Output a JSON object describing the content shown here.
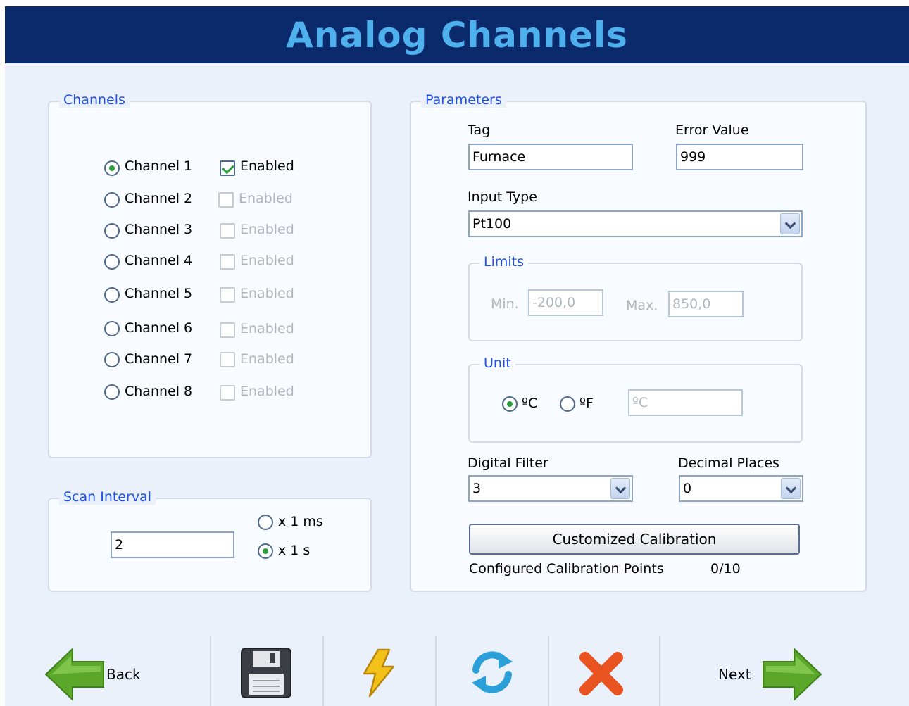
{
  "title": "Analog Channels",
  "channels": {
    "title": "Channels",
    "items": [
      {
        "label": "Channel 1",
        "enabled_label": "Enabled"
      },
      {
        "label": "Channel 2",
        "enabled_label": "Enabled"
      },
      {
        "label": "Channel 3",
        "enabled_label": "Enabled"
      },
      {
        "label": "Channel 4",
        "enabled_label": "Enabled"
      },
      {
        "label": "Channel 5",
        "enabled_label": "Enabled"
      },
      {
        "label": "Channel 6",
        "enabled_label": "Enabled"
      },
      {
        "label": "Channel 7",
        "enabled_label": "Enabled"
      },
      {
        "label": "Channel 8",
        "enabled_label": "Enabled"
      }
    ]
  },
  "scan_interval": {
    "title": "Scan Interval",
    "value": "2",
    "option_ms": "x 1 ms",
    "option_s": "x 1 s"
  },
  "parameters": {
    "title": "Parameters",
    "tag_label": "Tag",
    "tag_value": "Furnace",
    "error_value_label": "Error Value",
    "error_value": "999",
    "input_type_label": "Input Type",
    "input_type_value": "Pt100",
    "limits": {
      "title": "Limits",
      "min_label": "Min.",
      "min_value": "-200,0",
      "max_label": "Max.",
      "max_value": "850,0"
    },
    "unit": {
      "title": "Unit",
      "celsius": "ºC",
      "fahrenheit": "ºF",
      "display_value": "ºC"
    },
    "digital_filter_label": "Digital Filter",
    "digital_filter_value": "3",
    "decimal_places_label": "Decimal Places",
    "decimal_places_value": "0",
    "calibration_button": "Customized Calibration",
    "calibration_points_label": "Configured Calibration Points",
    "calibration_points_value": "0/10"
  },
  "toolbar": {
    "back_label": "Back",
    "next_label": "Next"
  },
  "colors": {
    "title_bar": "#0b2a6b",
    "title_text": "#4fb0ee",
    "group_title": "#1e50e6",
    "radio_dot": "#2a9d3c",
    "arrow_green": "#5aa72a",
    "cancel_red": "#e8531f"
  }
}
